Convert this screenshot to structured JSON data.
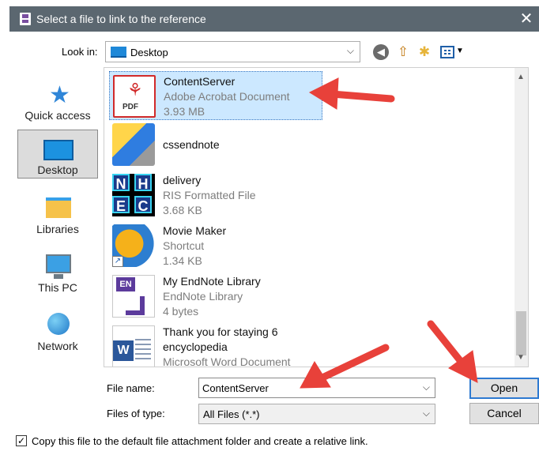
{
  "window": {
    "title": "Select a file to link to the reference",
    "close_glyph": "✕"
  },
  "toolbar": {
    "lookin_label": "Look in:",
    "lookin_value": "Desktop",
    "icons": [
      "back-icon",
      "up-folder-icon",
      "new-folder-icon",
      "view-menu-icon"
    ]
  },
  "places": [
    {
      "label": "Quick access",
      "icon": "star-icon"
    },
    {
      "label": "Desktop",
      "icon": "desktop-icon",
      "selected": true
    },
    {
      "label": "Libraries",
      "icon": "libraries-icon"
    },
    {
      "label": "This PC",
      "icon": "computer-icon"
    },
    {
      "label": "Network",
      "icon": "network-icon"
    }
  ],
  "files": [
    {
      "name": "ContentServer",
      "type": "Adobe Acrobat Document",
      "size": "3.93 MB",
      "icon": "pdf-icon",
      "selected": true
    },
    {
      "name": "cssendnote",
      "type": "",
      "size": "",
      "icon": "app-icon"
    },
    {
      "name": "delivery",
      "type": "RIS Formatted File",
      "size": "3.68 KB",
      "icon": "ris-icon"
    },
    {
      "name": "Movie Maker",
      "type": "Shortcut",
      "size": "1.34 KB",
      "icon": "movie-maker-icon"
    },
    {
      "name": "My EndNote Library",
      "type": "EndNote Library",
      "size": "4 bytes",
      "icon": "endnote-icon"
    },
    {
      "name": "Thank you for staying 6",
      "name_line2": "encyclopedia",
      "type": "Microsoft Word Document",
      "size": "",
      "icon": "word-icon"
    }
  ],
  "form": {
    "file_name_label": "File name:",
    "file_name_value": "ContentServer",
    "file_type_label": "Files of type:",
    "file_type_value": "All Files (*.*)",
    "open_label": "Open",
    "cancel_label": "Cancel"
  },
  "copy_option": {
    "checked": true,
    "label": "Copy this file to the default file attachment folder and create a relative link."
  },
  "colors": {
    "accent_arrow": "#e8413a",
    "titlebar": "#5b6770",
    "selection": "#cce8ff"
  }
}
